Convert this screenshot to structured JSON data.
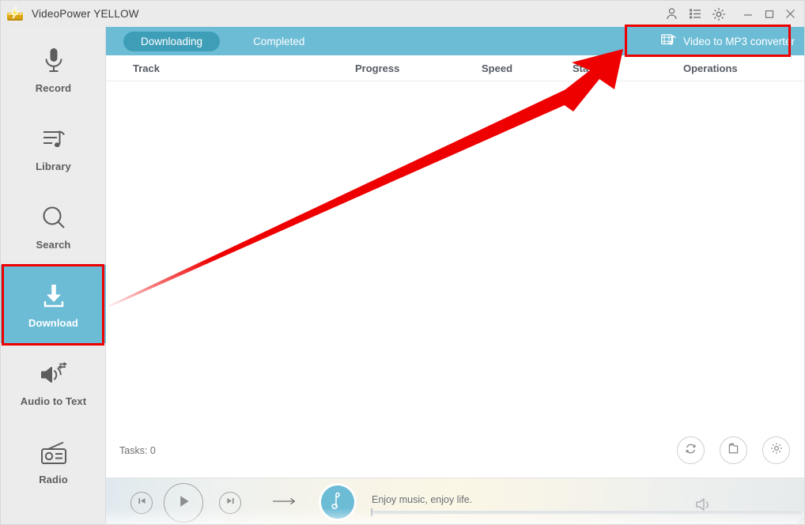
{
  "window": {
    "title": "VideoPower YELLOW",
    "app_icon": "videopower-logo-icon",
    "titlebar_icons": [
      {
        "name": "user-account-icon",
        "glyph": "user"
      },
      {
        "name": "task-list-icon",
        "glyph": "list"
      },
      {
        "name": "settings-gear-icon",
        "glyph": "gear"
      }
    ],
    "controls": {
      "minimize": "minimize-icon",
      "maximize": "maximize-icon",
      "close": "close-icon"
    }
  },
  "sidebar": {
    "items": [
      {
        "label": "Record",
        "icon": "microphone-icon",
        "active": false
      },
      {
        "label": "Library",
        "icon": "playlist-music-icon",
        "active": false
      },
      {
        "label": "Search",
        "icon": "magnifier-icon",
        "active": false
      },
      {
        "label": "Download",
        "icon": "download-arrow-icon",
        "active": true
      },
      {
        "label": "Audio to Text",
        "icon": "speaker-convert-icon",
        "active": false
      },
      {
        "label": "Radio",
        "icon": "radio-icon",
        "active": false
      }
    ]
  },
  "main": {
    "tabs": [
      {
        "label": "Downloading",
        "active": true
      },
      {
        "label": "Completed",
        "active": false
      }
    ],
    "converter_button": {
      "label": "Video to MP3 converter",
      "icon": "video-to-mp3-icon"
    },
    "columns": [
      {
        "label": "Track"
      },
      {
        "label": "Progress"
      },
      {
        "label": "Speed"
      },
      {
        "label": "Sta"
      },
      {
        "label": "Operations"
      }
    ],
    "rows": [],
    "tasks_label": "Tasks: 0",
    "tool_buttons": [
      {
        "name": "refresh-button",
        "icon": "refresh-icon"
      },
      {
        "name": "open-folder-button",
        "icon": "folder-icon"
      },
      {
        "name": "settings-button",
        "icon": "gear-icon"
      }
    ]
  },
  "player": {
    "prev": "previous-track-icon",
    "play": "play-icon",
    "next": "next-track-icon",
    "repeat": "repeat-arrow-icon",
    "album_icon": "music-note-icon",
    "song_text": "Enjoy music, enjoy life.",
    "progress_percent": 0,
    "volume": "volume-icon"
  },
  "annotations": {
    "arrow_color": "#ee0000",
    "highlight_color": "#ee0000",
    "highlighted": [
      "Download",
      "Video to MP3 converter"
    ]
  },
  "colors": {
    "teal": "#6CBCD6",
    "teal_dark": "#3E9EB8",
    "sidebar_bg": "#ececed",
    "titlebar_bg": "#ebebeb",
    "accent_red": "#ee0000"
  }
}
